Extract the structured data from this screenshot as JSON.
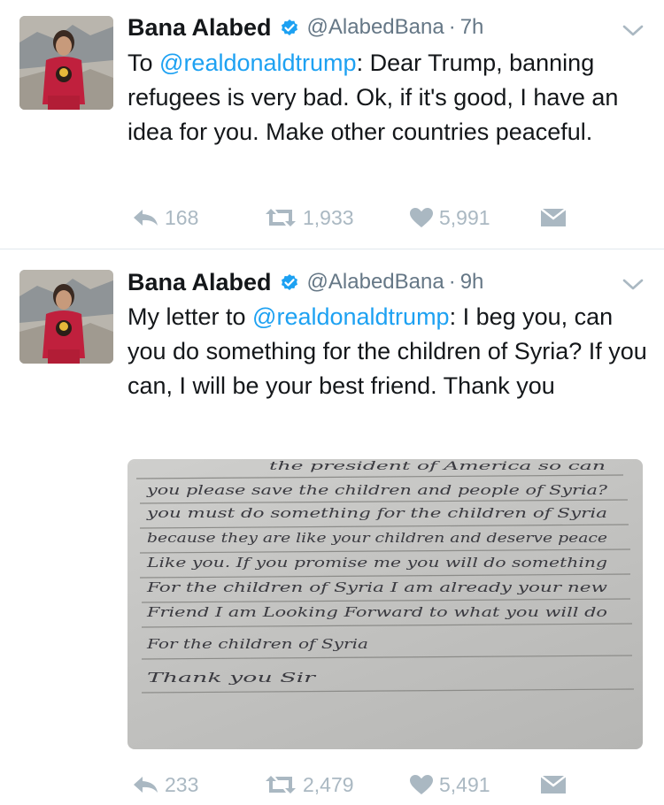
{
  "tweets": [
    {
      "name": "Bana Alabed",
      "handle": "@AlabedBana",
      "separator": "·",
      "time": "7h",
      "text_parts": [
        "To ",
        "@realdonaldtrump",
        ": Dear Trump, banning refugees is very bad. Ok, if it's good, I have an idea for you. Make other countries peaceful."
      ],
      "replies": "168",
      "retweets": "1,933",
      "likes": "5,991"
    },
    {
      "name": "Bana Alabed",
      "handle": "@AlabedBana",
      "separator": "·",
      "time": "9h",
      "text_parts": [
        "My letter to ",
        "@realdonaldtrump",
        ": I beg you, can you do something for the children of Syria? If you can, I will be your best friend. Thank you"
      ],
      "replies": "233",
      "retweets": "2,479",
      "likes": "5,491",
      "letter_lines": [
        "the president of America so can",
        "you please save the children and people of Syria?",
        "you must do something for the children of Syria",
        "because they are like your children and deserve peace",
        "Like you. If you promise me you will do something",
        "For the children of Syria I am already your new",
        "Friend I am Looking Forward to what you will do",
        "For the children of Syria",
        "Thank you Sir"
      ]
    }
  ],
  "colors": {
    "link": "#1da1f2",
    "verified": "#1da1f2",
    "secondary": "#657786",
    "action": "#aab8c2",
    "divider": "#e1e8ed"
  },
  "icons": [
    "verified-badge-icon",
    "chevron-down-icon",
    "reply-icon",
    "retweet-icon",
    "heart-icon",
    "envelope-icon"
  ]
}
